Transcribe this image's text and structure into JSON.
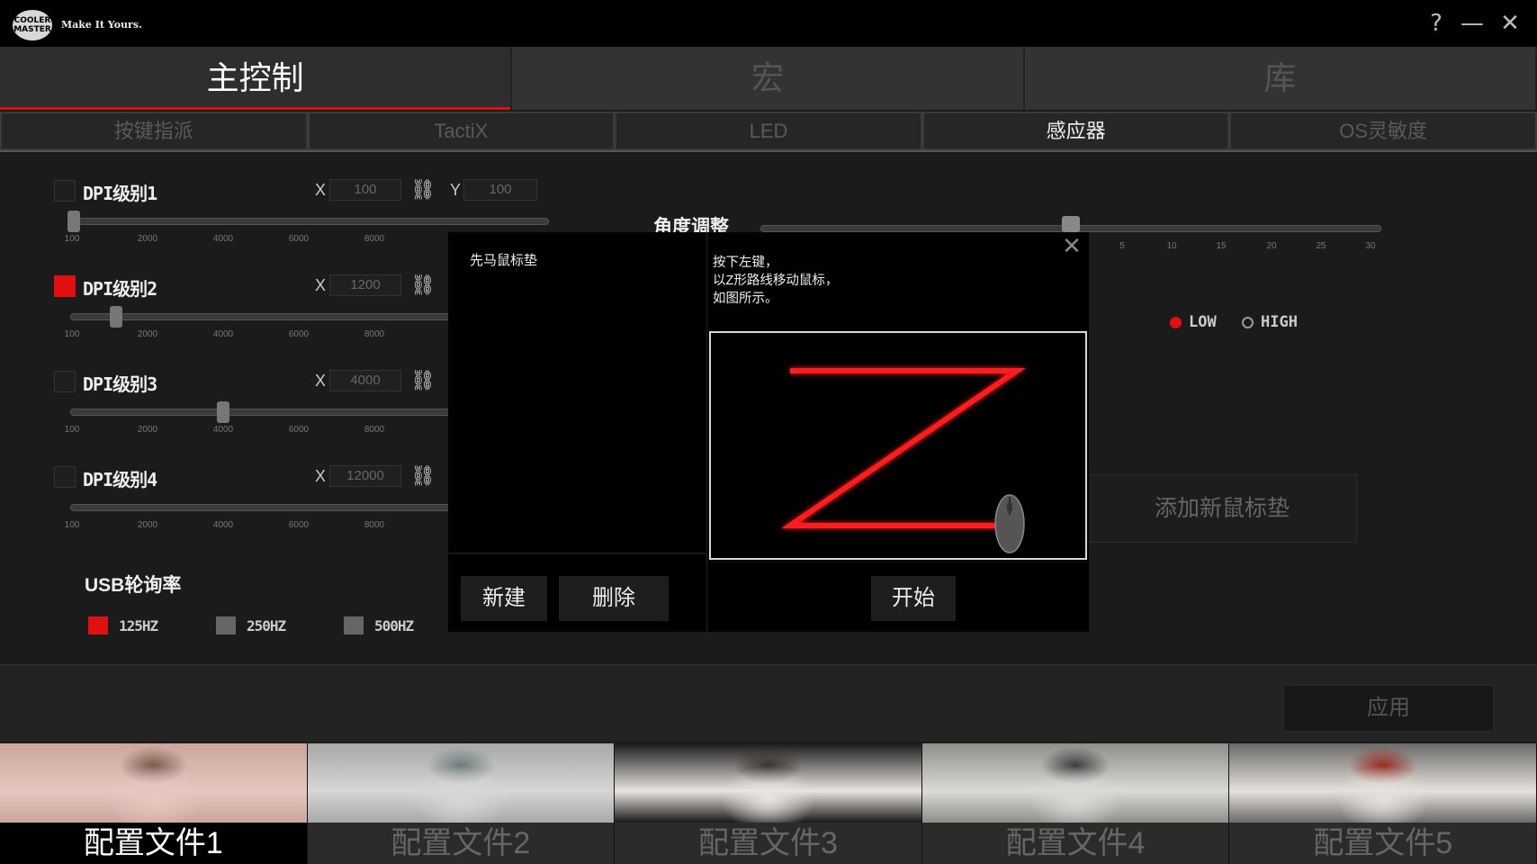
{
  "titlebar": {
    "logo_text": "COOLER MASTER",
    "tagline": "Make It Yours.",
    "help": "?",
    "minimize": "—",
    "close": "✕"
  },
  "main_tabs": [
    {
      "label": "主控制",
      "active": true
    },
    {
      "label": "宏",
      "active": false
    },
    {
      "label": "库",
      "active": false
    }
  ],
  "sub_tabs": [
    {
      "label": "按键指派",
      "active": false
    },
    {
      "label": "TactiX",
      "active": false
    },
    {
      "label": "LED",
      "active": false
    },
    {
      "label": "感应器",
      "active": true
    },
    {
      "label": "OS灵敏度",
      "active": false
    }
  ],
  "dpi": {
    "axis_x": "X",
    "axis_y": "Y",
    "ticks": [
      "100",
      "2000",
      "4000",
      "6000",
      "8000"
    ],
    "levels": [
      {
        "label": "DPI级别1",
        "checked": false,
        "x": "100",
        "y": "100",
        "slider_value": 100
      },
      {
        "label": "DPI级别2",
        "checked": true,
        "x": "1200",
        "slider_value": 1200
      },
      {
        "label": "DPI级别3",
        "checked": false,
        "x": "4000",
        "slider_value": 4000
      },
      {
        "label": "DPI级别4",
        "checked": false,
        "x": "12000",
        "slider_value": 12000
      }
    ]
  },
  "usb": {
    "title": "USB轮询率",
    "options": [
      {
        "label": "125HZ",
        "checked": true
      },
      {
        "label": "250HZ",
        "checked": false
      },
      {
        "label": "500HZ",
        "checked": false
      }
    ]
  },
  "angle": {
    "label": "角度调整",
    "ticks": [
      "5",
      "10",
      "15",
      "20",
      "25",
      "30"
    ]
  },
  "lift_height": {
    "low": "LOW",
    "high": "HIGH",
    "selected": "LOW"
  },
  "add_pad_label": "添加新鼠标垫",
  "dialog": {
    "pad_item": "先马鼠标垫",
    "instructions": [
      "按下左键，",
      "以Z形路线移动鼠标，",
      "如图所示。"
    ],
    "new_label": "新建",
    "delete_label": "删除",
    "start_label": "开始",
    "close": "✕"
  },
  "apply_label": "应用",
  "profiles": [
    {
      "label": "配置文件1",
      "active": true,
      "colors": [
        "#c9a79b",
        "#e8c6c0",
        "#7a5b4d"
      ]
    },
    {
      "label": "配置文件2",
      "active": false,
      "colors": [
        "#a7a9a7",
        "#d7d7d5",
        "#6f7a7c"
      ]
    },
    {
      "label": "配置文件3",
      "active": false,
      "colors": [
        "#1a1a1a",
        "#e9e4e0",
        "#3b3633"
      ]
    },
    {
      "label": "配置文件4",
      "active": false,
      "colors": [
        "#8f8e88",
        "#dadad6",
        "#3a3d3f"
      ]
    },
    {
      "label": "配置文件5",
      "active": false,
      "colors": [
        "#6c6a66",
        "#e5e2de",
        "#9b2a22"
      ]
    }
  ],
  "colors": {
    "accent": "#e01010"
  }
}
